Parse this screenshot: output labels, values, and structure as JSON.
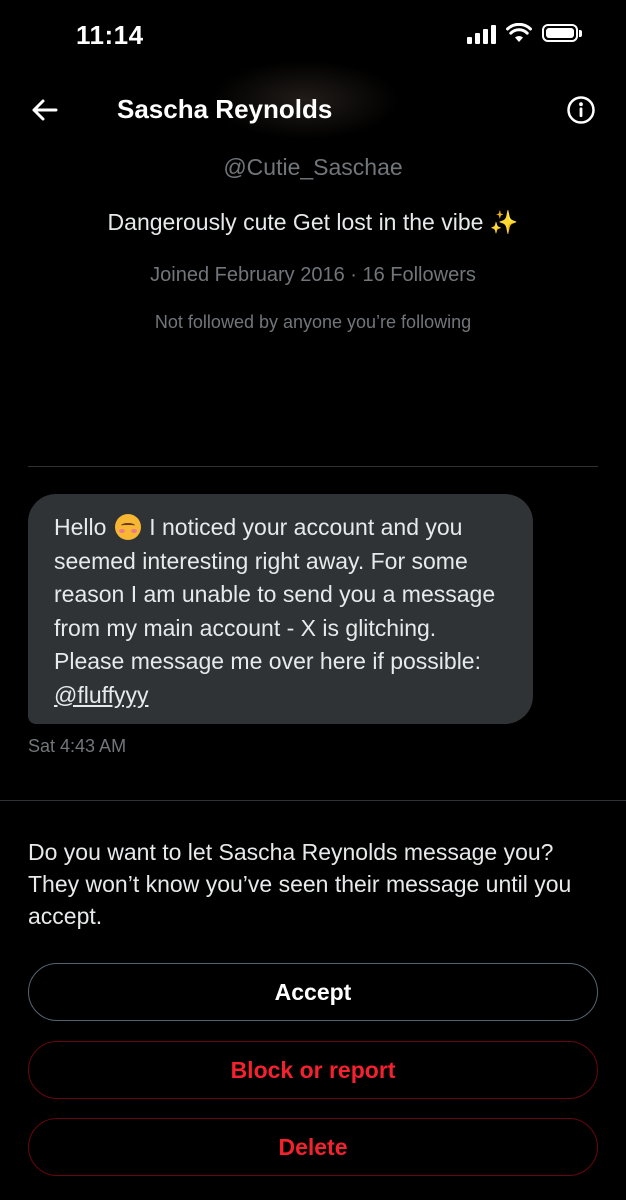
{
  "status_bar": {
    "time": "11:14",
    "icons": [
      "cellular-signal-icon",
      "wifi-icon",
      "battery-icon"
    ]
  },
  "header": {
    "title": "Sascha Reynolds",
    "back_icon": "back-arrow-icon",
    "info_icon": "info-icon"
  },
  "profile": {
    "handle": "@Cutie_Saschae",
    "bio": "Dangerously cute Get lost in the vibe ✨",
    "meta": "Joined February 2016 · 16 Followers",
    "mutuals": "Not followed by anyone you’re following"
  },
  "message": {
    "greeting": "Hello",
    "emoji": "smiling-face-with-blush-icon",
    "body": "I noticed your account and you seemed interesting right away. For some reason I am unable to send you a message from my main account - X is glitching. Please message me over here if possible:",
    "mention": "@fluffyyy",
    "timestamp": "Sat 4:43 AM"
  },
  "request": {
    "prompt": "Do you want to let Sascha Reynolds message you? They won’t know you’ve seen their message until you accept.",
    "accept_label": "Accept",
    "block_label": "Block or report",
    "delete_label": "Delete"
  },
  "colors": {
    "background": "#000000",
    "text_primary": "#e7e9ea",
    "text_secondary": "#71767b",
    "bubble": "#2f3336",
    "danger": "#f4212e"
  }
}
